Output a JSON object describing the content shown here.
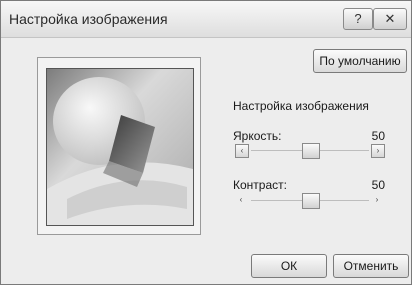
{
  "window": {
    "title": "Настройка изображения",
    "help_label": "?",
    "close_label": "✕"
  },
  "buttons": {
    "default_label": "По умолчанию",
    "ok_label": "ОК",
    "cancel_label": "Отменить"
  },
  "settings": {
    "group_label": "Настройка изображения",
    "brightness": {
      "label": "Яркость:",
      "value": "50",
      "level_percent": 50
    },
    "contrast": {
      "label": "Контраст:",
      "value": "50",
      "level_percent": 50
    }
  },
  "icons": {
    "left_arrow": "‹",
    "right_arrow": "›"
  }
}
